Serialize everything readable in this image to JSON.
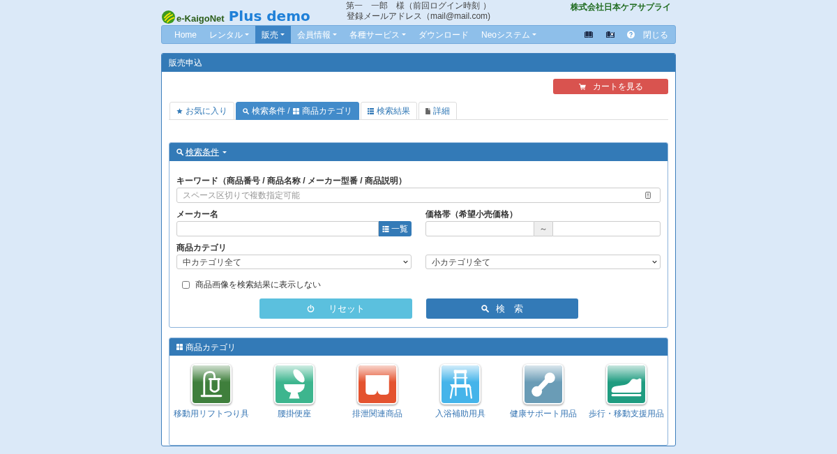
{
  "header": {
    "logo": {
      "brand": "e-KaigoNet",
      "edition": "Plus demo"
    },
    "user": "第一　一郎　様（前回ログイン時刻 ）",
    "email": "登録メールアドレス（mail@mail.com)",
    "company": "株式会社日本ケアサプライ"
  },
  "navbar": {
    "items": [
      {
        "label": "Home",
        "dropdown": false,
        "selected": false
      },
      {
        "label": "レンタル",
        "dropdown": true,
        "selected": false
      },
      {
        "label": "販売",
        "dropdown": true,
        "selected": true
      },
      {
        "label": "会員情報",
        "dropdown": true,
        "selected": false
      },
      {
        "label": "各種サービス",
        "dropdown": true,
        "selected": false
      },
      {
        "label": "ダウンロード",
        "dropdown": false,
        "selected": false
      },
      {
        "label": "Neoシステム",
        "dropdown": true,
        "selected": false
      }
    ],
    "close": "閉じる"
  },
  "order_panel": {
    "title": "販売申込",
    "cart_button": "カートを見る",
    "tabs": [
      {
        "kind": "favorites",
        "texts": [
          "お気に入り"
        ],
        "selected": false
      },
      {
        "kind": "criteria",
        "texts": [
          "検索条件 /",
          "商品カテゴリ"
        ],
        "selected": true
      },
      {
        "kind": "results",
        "texts": [
          "検索結果"
        ],
        "selected": false
      },
      {
        "kind": "detail",
        "texts": [
          "詳細"
        ],
        "selected": false
      }
    ],
    "search": {
      "title": "検索条件",
      "keyword": {
        "label": "キーワード（商品番号 / 商品名称 / メーカー型番 / 商品説明）",
        "placeholder": "スペース区切りで複数指定可能"
      },
      "maker": {
        "label": "メーカー名",
        "button": "一覧"
      },
      "price": {
        "label": "価格帯（希望小売価格）",
        "separator": "～"
      },
      "category": {
        "label": "商品カテゴリ",
        "middle": "中カテゴリ全て",
        "small": "小カテゴリ全て"
      },
      "hide_images": {
        "label": "商品画像を検索結果に表示しない",
        "checked": false
      },
      "reset_button": "リセット",
      "search_button": "検　索"
    },
    "categories": {
      "title": "商品カテゴリ",
      "items": [
        {
          "label": "移動用リフトつり具",
          "kind": "hoist",
          "color": "#3f7f3c"
        },
        {
          "label": "腰掛便座",
          "kind": "toilet",
          "color": "#3db58e"
        },
        {
          "label": "排泄関連商品",
          "kind": "underwear",
          "color": "#e4532f"
        },
        {
          "label": "入浴補助用具",
          "kind": "chair",
          "color": "#45b4ea"
        },
        {
          "label": "健康サポート用品",
          "kind": "dumbbell",
          "color": "#6a9cb6"
        },
        {
          "label": "歩行・移動支援用品",
          "kind": "shoe",
          "color": "#1f9c80"
        }
      ]
    }
  }
}
